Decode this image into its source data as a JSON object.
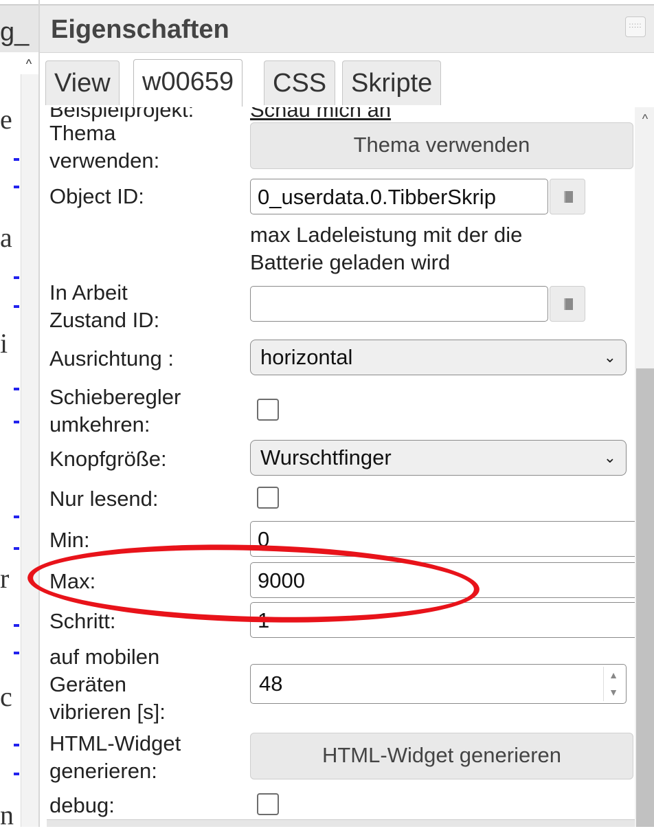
{
  "background_panel": {
    "title_fragment": "g_",
    "letters": [
      "e",
      "a",
      "i",
      "r",
      "c",
      "n"
    ]
  },
  "panel": {
    "title": "Eigenschaften",
    "menu_icon": "grip-icon",
    "tabs": [
      {
        "label": "View",
        "active": false
      },
      {
        "label": "w00659",
        "active": true
      },
      {
        "label": "CSS",
        "active": false
      },
      {
        "label": "Skripte",
        "active": false
      }
    ]
  },
  "properties": {
    "cut_row": {
      "label": "Beispielprojekt:",
      "link": "Schau mich an"
    },
    "theme": {
      "label_line1": "Thema",
      "label_line2": "verwenden:",
      "button": "Thema verwenden"
    },
    "object_id": {
      "label": "Object ID:",
      "value": "0_userdata.0.TibberSkrip",
      "description_line1": "max Ladeleistung mit der die",
      "description_line2": "Batterie geladen wird"
    },
    "work_state": {
      "label_line1": "In Arbeit",
      "label_line2": "Zustand ID:",
      "value": ""
    },
    "orientation": {
      "label": "Ausrichtung :",
      "value": "horizontal"
    },
    "invert_slider": {
      "label_line1": "Schieberegler",
      "label_line2": "umkehren:",
      "checked": false
    },
    "knob_size": {
      "label": "Knopfgröße:",
      "value": "Wurschtfinger"
    },
    "read_only": {
      "label": "Nur lesend:",
      "checked": false
    },
    "min": {
      "label": "Min:",
      "value": "0"
    },
    "max": {
      "label": "Max:",
      "value": "9000"
    },
    "step": {
      "label": "Schritt:",
      "value": "1"
    },
    "vibrate": {
      "label_line1": "auf mobilen",
      "label_line2": "Geräten",
      "label_line3": "vibrieren [s]:",
      "value": "48"
    },
    "html_widget": {
      "label_line1": "HTML-Widget",
      "label_line2": "generieren:",
      "button": "HTML-Widget generieren"
    },
    "debug": {
      "label": "debug:",
      "checked": false
    }
  },
  "annotation": {
    "color": "#e8131a",
    "target": "Max"
  }
}
